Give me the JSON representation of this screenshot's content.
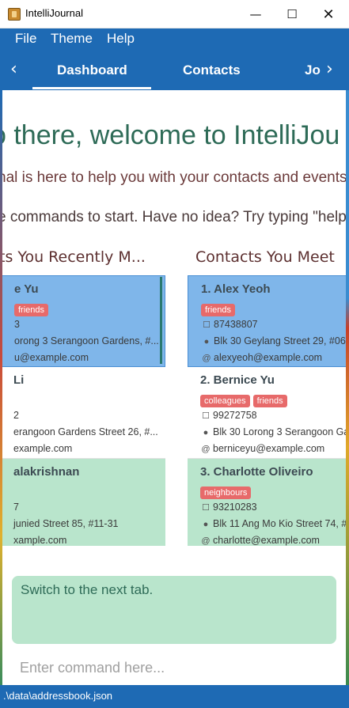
{
  "window": {
    "title": "IntelliJournal",
    "minimize": "—",
    "maximize": "☐",
    "close": "✕"
  },
  "menu": [
    "File",
    "Theme",
    "Help"
  ],
  "tabs": [
    "Dashboard",
    "Contacts",
    "Jo"
  ],
  "tab_prev": "‹",
  "tab_next": "›",
  "welcome": {
    "heading": "o there, welcome to IntelliJou",
    "line1": "nal is here to help you with your contacts and events",
    "line2": "e commands to start. Have no idea? Try typing \"help"
  },
  "recent": {
    "header": "ts You Recently M...",
    "items": [
      {
        "name": "e Yu",
        "tags": [
          "friends"
        ],
        "phone": "3",
        "address": "orong 3 Serangoon Gardens, #...",
        "email": "u@example.com"
      },
      {
        "name": "Li",
        "tags": [],
        "phone": "2",
        "address": "erangoon Gardens Street 26, #...",
        "email": "example.com"
      },
      {
        "name": "alakrishnan",
        "tags": [],
        "phone": "7",
        "address": "junied Street 85, #11-31",
        "email": "xample.com"
      }
    ]
  },
  "meet": {
    "header": "Contacts You Meet",
    "items": [
      {
        "name": "1.  Alex Yeoh",
        "tags": [
          "friends"
        ],
        "phone": "87438807",
        "address": "Blk 30 Geylang Street 29, #06",
        "email": "alexyeoh@example.com"
      },
      {
        "name": "2.  Bernice Yu",
        "tags": [
          "colleagues",
          "friends"
        ],
        "phone": "99272758",
        "address": "Blk 30 Lorong 3 Serangoon Ga",
        "email": "berniceyu@example.com"
      },
      {
        "name": "3.  Charlotte Oliveiro",
        "tags": [
          "neighbours"
        ],
        "phone": "93210283",
        "address": "Blk 11 Ang Mo Kio Street 74, #",
        "email": "charlotte@example.com"
      }
    ]
  },
  "result": "Switch to the next tab.",
  "command": {
    "placeholder": "Enter command here...",
    "value": ""
  },
  "status": ".\\data\\addressbook.json",
  "icons": {
    "phone": "phone-icon",
    "address": "location-icon",
    "email": "at-icon"
  },
  "colors": {
    "primary": "#1e6ab4",
    "selected": "#7fb6ea",
    "alt_row": "#b9e5cc",
    "tag": "#e76a6a",
    "heading": "#2e6b57"
  }
}
